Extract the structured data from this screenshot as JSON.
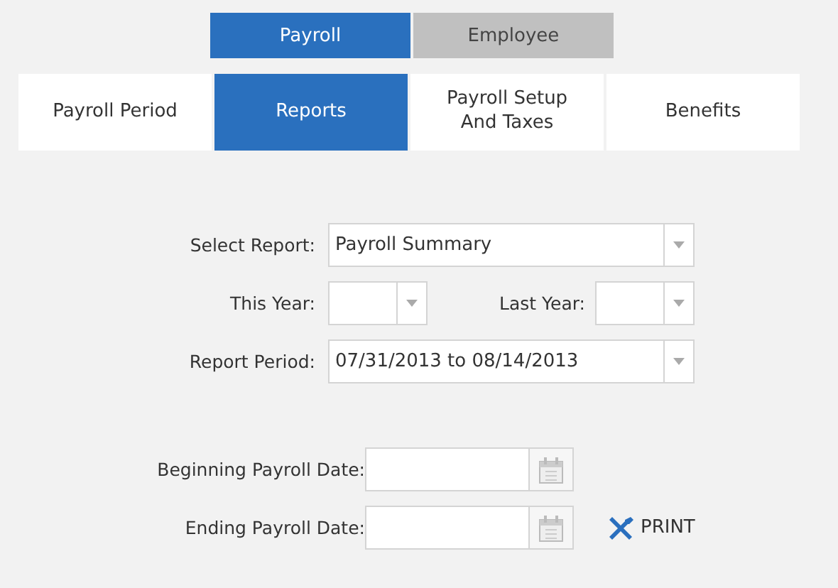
{
  "top_tabs": [
    {
      "label": "Payroll",
      "selected": true
    },
    {
      "label": "Employee",
      "selected": false
    }
  ],
  "sub_tabs": [
    {
      "label": "Payroll Period",
      "selected": false
    },
    {
      "label": "Reports",
      "selected": true
    },
    {
      "label": "Payroll Setup And Taxes",
      "selected": false
    },
    {
      "label": "Benefits",
      "selected": false
    }
  ],
  "select_report": {
    "label": "Select Report:",
    "value": "Payroll Summary"
  },
  "this_year": {
    "label": "This Year:"
  },
  "last_year": {
    "label": "Last Year:"
  },
  "report_period": {
    "label": "Report Period:",
    "value": "07/31/2013 to 08/14/2013"
  },
  "beginning_date": {
    "label": "Beginning Payroll Date:"
  },
  "ending_date": {
    "label": "Ending Payroll Date:"
  },
  "print_button": {
    "label": "PRINT"
  }
}
